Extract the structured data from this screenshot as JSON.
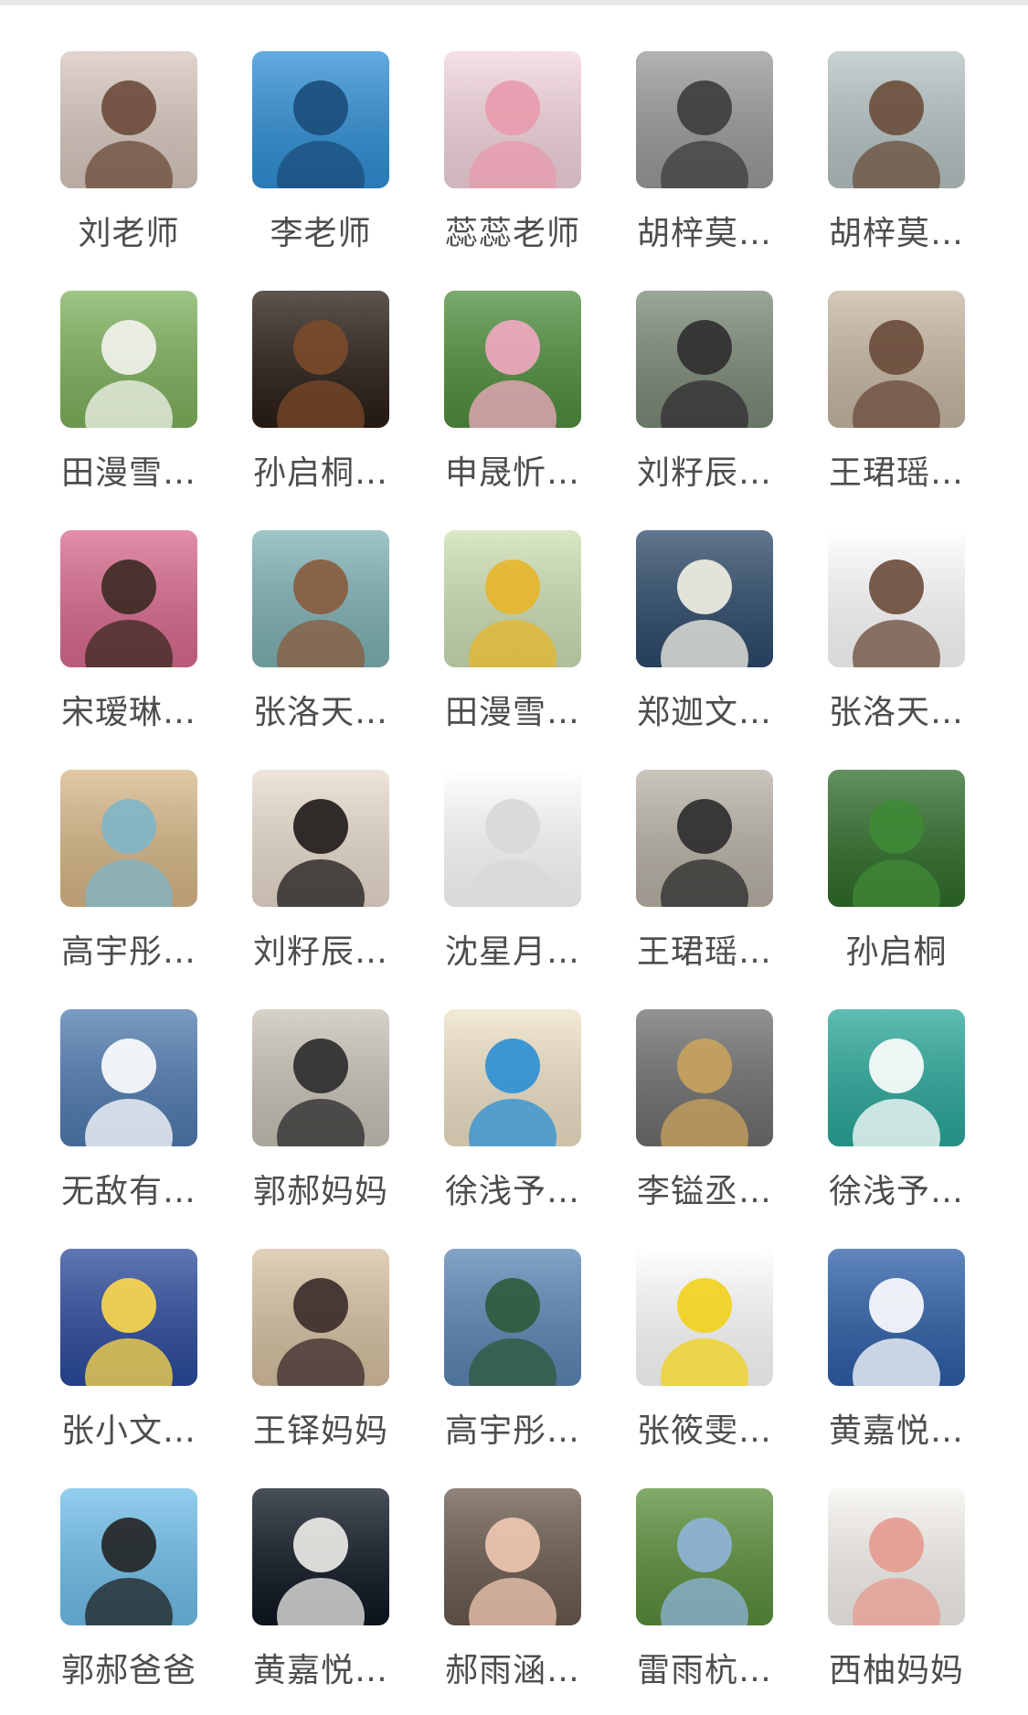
{
  "members": [
    {
      "name": "刘老师",
      "avatar": "woman-portrait-heart-icon",
      "bg": "#d8c9bf",
      "fg": "#6b4a3a"
    },
    {
      "name": "李老师",
      "avatar": "fish-underwater-icon",
      "bg": "#2f8fd6",
      "fg": "#1b4c7a"
    },
    {
      "name": "蕊蕊老师",
      "avatar": "anime-girl-icon",
      "bg": "#f4d6de",
      "fg": "#e89aad"
    },
    {
      "name": "胡梓莫…",
      "avatar": "parent-child-walking-icon",
      "bg": "#9a9a9a",
      "fg": "#3c3c3c"
    },
    {
      "name": "胡梓莫…",
      "avatar": "bear-beach-icon",
      "bg": "#b7c4c4",
      "fg": "#6a4e3a"
    },
    {
      "name": "田漫雪…",
      "avatar": "wedding-photo-icon",
      "bg": "#7fb25c",
      "fg": "#f3f3ee"
    },
    {
      "name": "孙启桐…",
      "avatar": "puppy-fisheye-icon",
      "bg": "#2a1d16",
      "fg": "#7a4a2a"
    },
    {
      "name": "申晟忻…",
      "avatar": "lotus-flower-icon",
      "bg": "#4f8f3d",
      "fg": "#f2a9c1"
    },
    {
      "name": "刘籽辰…",
      "avatar": "man-glasses-portrait-icon",
      "bg": "#7c8a78",
      "fg": "#2e2e2e"
    },
    {
      "name": "王珺瑶…",
      "avatar": "mother-child-kiss-icon",
      "bg": "#c7b8a4",
      "fg": "#6a4a3a"
    },
    {
      "name": "宋瑷琳…",
      "avatar": "child-flower-crown-icon",
      "bg": "#d96a8e",
      "fg": "#3b2a22"
    },
    {
      "name": "张洛天…",
      "avatar": "cartoon-girl-icon",
      "bg": "#7fb2b5",
      "fg": "#8a5b3c"
    },
    {
      "name": "田漫雪…",
      "avatar": "sunflower-icon",
      "bg": "#cfe0b4",
      "fg": "#e7b62a"
    },
    {
      "name": "郑迦文…",
      "avatar": "swan-night-icon",
      "bg": "#2d4a6a",
      "fg": "#f4f2e6"
    },
    {
      "name": "张洛天…",
      "avatar": "cartoon-boy-icon",
      "bg": "#ffffff",
      "fg": "#6b4a3a"
    },
    {
      "name": "高宇彤…",
      "avatar": "beach-child-icon",
      "bg": "#d8b887",
      "fg": "#7fb6c9"
    },
    {
      "name": "刘籽辰…",
      "avatar": "woman-mouse-ears-icon",
      "bg": "#e9dccd",
      "fg": "#1e1a18"
    },
    {
      "name": "沈星月…",
      "avatar": "sleeping-cat-icon",
      "bg": "#ffffff",
      "fg": "#d8d8d8"
    },
    {
      "name": "王珺瑶…",
      "avatar": "man-sitting-icon",
      "bg": "#b9b2a7",
      "fg": "#2b2b2b"
    },
    {
      "name": "孙启桐",
      "avatar": "green-grass-icon",
      "bg": "#2f6d2a",
      "fg": "#3f8a35"
    },
    {
      "name": "无敌有…",
      "avatar": "swans-pattern-icon",
      "bg": "#4f7bb0",
      "fg": "#ffffff"
    },
    {
      "name": "郭郝妈妈",
      "avatar": "window-silhouette-icon",
      "bg": "#c9c3b8",
      "fg": "#2a2a2a"
    },
    {
      "name": "徐浅予…",
      "avatar": "painted-plate-icon",
      "bg": "#efe3c7",
      "fg": "#2a8fd6"
    },
    {
      "name": "李镒丞…",
      "avatar": "plush-toy-mask-icon",
      "bg": "#6f6f6f",
      "fg": "#c9a35b"
    },
    {
      "name": "徐浅予…",
      "avatar": "boats-sea-icon",
      "bg": "#2aa89a",
      "fg": "#ffffff"
    },
    {
      "name": "张小文…",
      "avatar": "doraemon-moon-icon",
      "bg": "#2b4a9c",
      "fg": "#ffd84a"
    },
    {
      "name": "王铎妈妈",
      "avatar": "woman-room-icon",
      "bg": "#d8c2a2",
      "fg": "#3a2a2a"
    },
    {
      "name": "高宇彤…",
      "avatar": "coastline-icon",
      "bg": "#5b86b5",
      "fg": "#2f5a3a"
    },
    {
      "name": "张筱雯…",
      "avatar": "horse-shield-logo-icon",
      "bg": "#ffffff",
      "fg": "#f2d21a"
    },
    {
      "name": "黄嘉悦…",
      "avatar": "potted-plant-icon",
      "bg": "#2d5fa8",
      "fg": "#ffffff"
    },
    {
      "name": "郭郝爸爸",
      "avatar": "cartoon-man-glasses-icon",
      "bg": "#6fbfea",
      "fg": "#222222"
    },
    {
      "name": "黄嘉悦…",
      "avatar": "white-flower-dark-icon",
      "bg": "#0e1622",
      "fg": "#eeeeea"
    },
    {
      "name": "郝雨涵…",
      "avatar": "little-girl-portrait-icon",
      "bg": "#6a5a4e",
      "fg": "#f2c9b2"
    },
    {
      "name": "雷雨杭…",
      "avatar": "mountain-valley-icon",
      "bg": "#5a8f3a",
      "fg": "#8fb4d9"
    },
    {
      "name": "西柚妈妈",
      "avatar": "girl-desk-sketch-icon",
      "bg": "#f7f4ef",
      "fg": "#e59a8f"
    }
  ]
}
